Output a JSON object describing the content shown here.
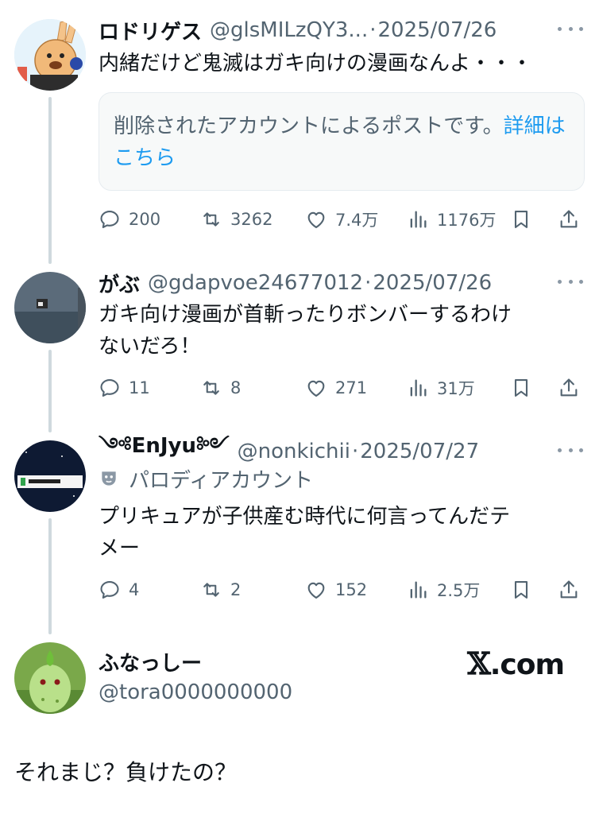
{
  "posts": [
    {
      "name": "ロドリゲス",
      "handle": "@glsMILzQY3...",
      "date": "2025/07/26",
      "text": "内緒だけど鬼滅はガキ向けの漫画なんよ・・・",
      "notice": "削除されたアカウントによるポストです。",
      "notice_link": "詳細はこちら",
      "replies": "200",
      "reposts": "3262",
      "likes": "7.4万",
      "views": "1176万"
    },
    {
      "name": "がぶ",
      "handle": "@gdapvoe24677012",
      "date": "2025/07/26",
      "text_line1": "ガキ向け漫画が首斬ったりボンバーするわけ",
      "text_line2": "ないだろ！",
      "replies": "11",
      "reposts": "8",
      "likes": "271",
      "views": "31万"
    },
    {
      "name": "༺EnJyu༻",
      "handle": "@nonkichii",
      "date": "2025/07/27",
      "parody_label": "パロディアカウント",
      "text_line1": "プリキュアが子供産む時代に何言ってんだテ",
      "text_line2": "メー",
      "replies": "4",
      "reposts": "2",
      "likes": "152",
      "views": "2.5万"
    }
  ],
  "quote": {
    "name": "ふなっしー",
    "handle": "@tora0000000000",
    "text": "それまじ？負けたの？"
  },
  "dot": "·",
  "brand": {
    "x": "𝕏",
    "suffix": ".com"
  },
  "colors": {
    "text": "#0f1419",
    "secondary": "#536471",
    "link": "#1d9bf0",
    "thread": "#cfd9de"
  }
}
